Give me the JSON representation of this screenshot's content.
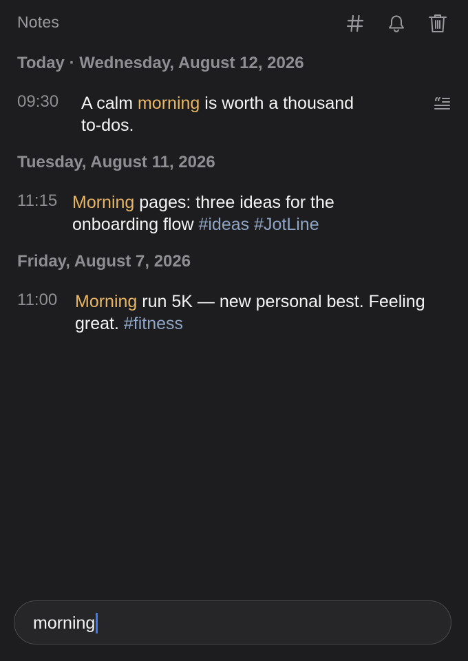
{
  "header": {
    "title": "Notes",
    "icons": [
      "hashtag-icon",
      "bell-icon",
      "trash-icon"
    ]
  },
  "feed": {
    "days": [
      {
        "heading": "Today · Wednesday, August 12, 2026",
        "entries": [
          {
            "time": "09:30",
            "segments": [
              {
                "text": "A calm ",
                "kind": "plain"
              },
              {
                "text": "morning",
                "kind": "highlight"
              },
              {
                "text": " is worth a thousand",
                "kind": "plain"
              },
              {
                "text": "to-dos.",
                "kind": "plain"
              }
            ],
            "action_icon": "quote-format-icon"
          }
        ]
      },
      {
        "heading": "Tuesday, August 11, 2026",
        "entries": [
          {
            "time": "11:15",
            "segments": [
              {
                "text": "Morning",
                "kind": "highlight"
              },
              {
                "text": " pages: three ideas for the",
                "kind": "plain"
              },
              {
                "text": "onboarding flow ",
                "kind": "plain"
              },
              {
                "text": "#ideas",
                "kind": "tag"
              },
              {
                "text": " ",
                "kind": "plain"
              },
              {
                "text": "#JotLine",
                "kind": "tag"
              }
            ]
          }
        ]
      },
      {
        "heading": "Friday, August 7, 2026",
        "entries": [
          {
            "time": "11:00",
            "segments": [
              {
                "text": "Morning",
                "kind": "highlight"
              },
              {
                "text": " run 5K — new personal best. Feeling",
                "kind": "plain"
              },
              {
                "text": "great. ",
                "kind": "plain"
              },
              {
                "text": "#fitness",
                "kind": "tag"
              }
            ]
          }
        ]
      }
    ]
  },
  "search": {
    "value": "morning"
  },
  "colors": {
    "background": "#1d1d1f",
    "highlight": "#e8b564",
    "tag": "#8fa5c6",
    "caret": "#3d7bf5",
    "muted": "#8e8e93"
  }
}
